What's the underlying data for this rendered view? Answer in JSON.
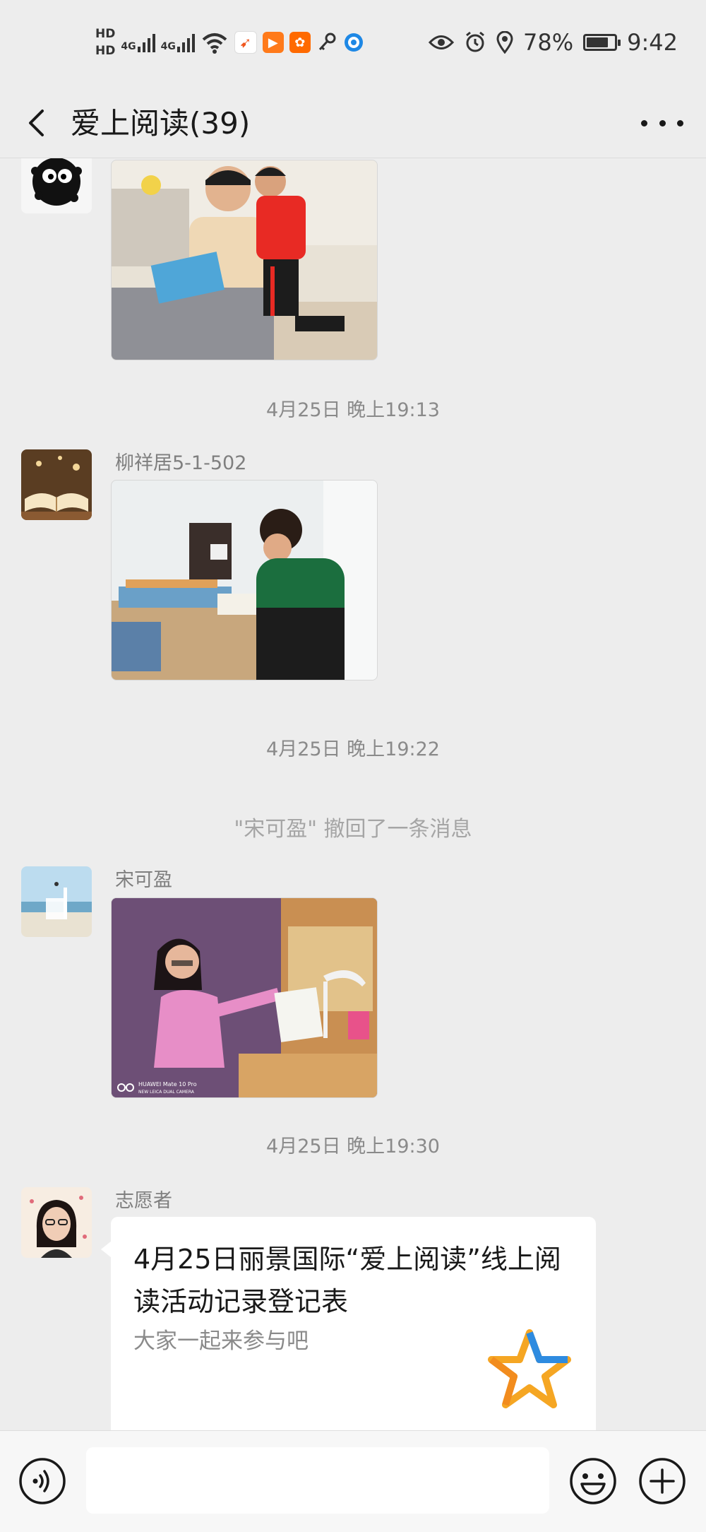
{
  "status_bar": {
    "hd1": "HD",
    "hd2": "HD",
    "network1": "4G",
    "network2": "4G",
    "battery_percent": "78%",
    "battery_level": 0.78,
    "time": "9:42"
  },
  "header": {
    "title": "爱上阅读(39)"
  },
  "messages": {
    "ts1": "4月25日 晚上19:13",
    "sender2": "柳祥居5-1-502",
    "ts2": "4月25日 晚上19:22",
    "recall_notice": "\"宋可盈\" 撤回了一条消息",
    "sender3": "宋可盈",
    "ts3": "4月25日 晚上19:30",
    "sender4": "志愿者",
    "photo3_watermark_line1": "HUAWEI Mate 10 Pro",
    "photo3_watermark_line2": "NEW LEICA DUAL CAMERA"
  },
  "card": {
    "title": "4月25日丽景国际“爱上阅读”线上阅读活动记录登记表",
    "desc": "大家一起来参与吧"
  },
  "input": {
    "value": ""
  },
  "colors": {
    "background": "#ededed",
    "card": "#ffffff",
    "bottom_bar": "#f7f7f7",
    "timestamp": "#8a8a8a"
  }
}
